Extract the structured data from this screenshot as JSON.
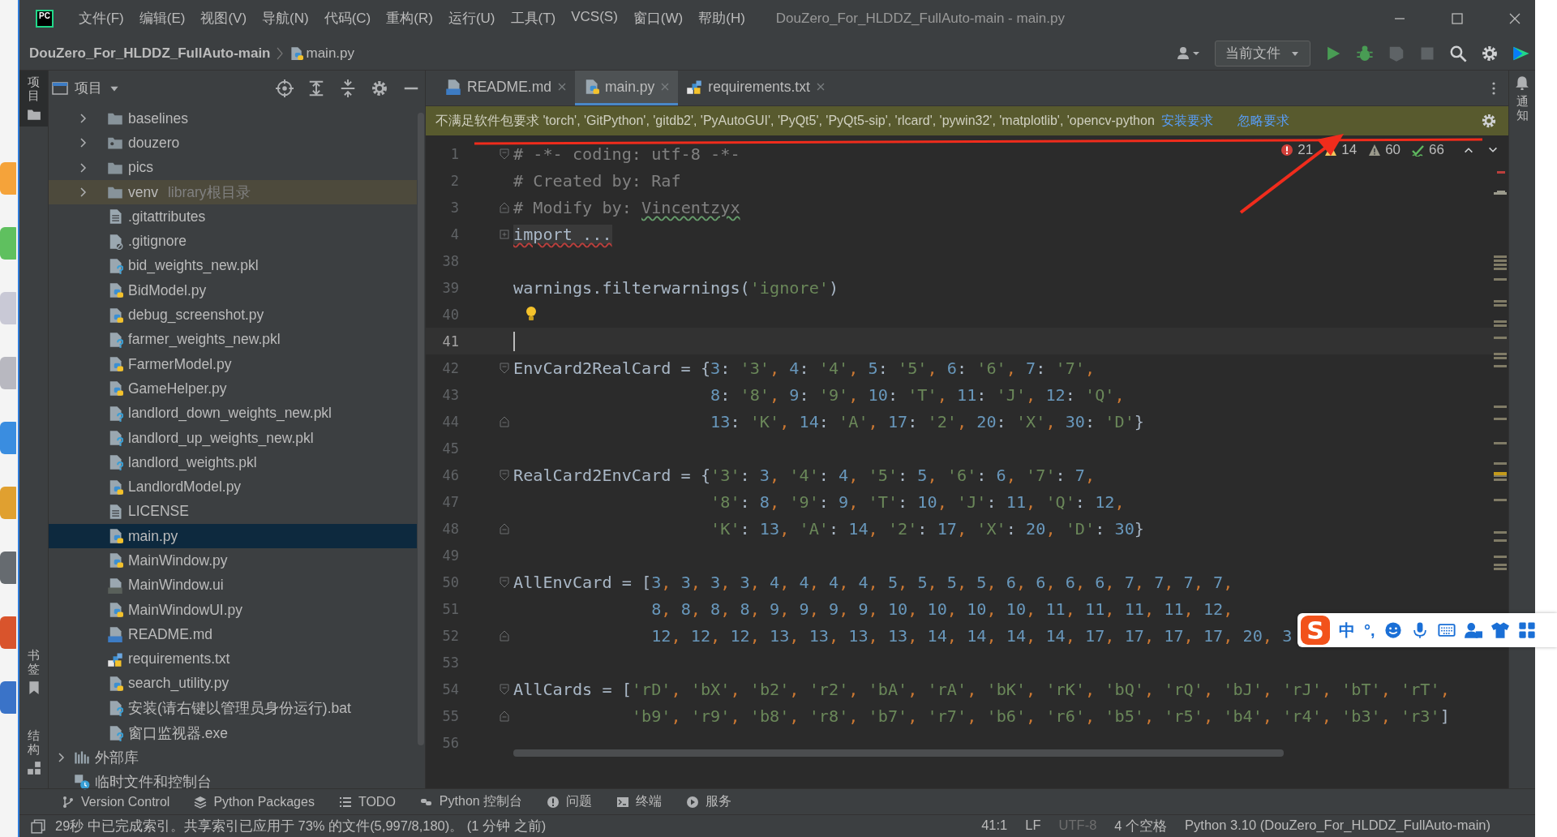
{
  "window": {
    "logo": "PC",
    "menu": [
      "文件(F)",
      "编辑(E)",
      "视图(V)",
      "导航(N)",
      "代码(C)",
      "重构(R)",
      "运行(U)",
      "工具(T)",
      "VCS(S)",
      "窗口(W)",
      "帮助(H)"
    ],
    "title": "DouZero_For_HLDDZ_FullAuto-main - main.py"
  },
  "navbar": {
    "breadcrumb": [
      {
        "label": "DouZero_For_HLDDZ_FullAuto-main",
        "kind": "project"
      },
      {
        "label": "main.py",
        "kind": "python"
      }
    ],
    "run_config": "当前文件"
  },
  "left_stripe": {
    "top": [
      {
        "label": "项目",
        "selected": true,
        "kind": "project"
      }
    ],
    "bottom": [
      {
        "label": "书签",
        "selected": false,
        "kind": "bookmarks"
      },
      {
        "label": "结构",
        "selected": false,
        "kind": "structure"
      }
    ]
  },
  "right_stripe": [
    {
      "label": "通知",
      "kind": "notifications"
    }
  ],
  "project_panel": {
    "title": "项目"
  },
  "tree": {
    "project_children": [
      {
        "label": "baselines",
        "kind": "folder",
        "expanded": false,
        "selected": false,
        "highlighted": false
      },
      {
        "label": "douzero",
        "kind": "module-folder",
        "expanded": false,
        "selected": false,
        "highlighted": false
      },
      {
        "label": "pics",
        "kind": "folder",
        "expanded": false,
        "selected": false,
        "highlighted": false
      },
      {
        "label": "venv",
        "hint": "library根目录",
        "kind": "folder",
        "expanded": false,
        "selected": false,
        "highlighted": true
      },
      {
        "label": ".gitattributes",
        "kind": "text",
        "selected": false,
        "highlighted": false
      },
      {
        "label": ".gitignore",
        "kind": "ignore",
        "selected": false,
        "highlighted": false
      },
      {
        "label": "bid_weights_new.pkl",
        "kind": "unknown",
        "selected": false,
        "highlighted": false
      },
      {
        "label": "BidModel.py",
        "kind": "python",
        "selected": false,
        "highlighted": false
      },
      {
        "label": "debug_screenshot.py",
        "kind": "python",
        "selected": false,
        "highlighted": false
      },
      {
        "label": "farmer_weights_new.pkl",
        "kind": "unknown",
        "selected": false,
        "highlighted": false
      },
      {
        "label": "FarmerModel.py",
        "kind": "python",
        "selected": false,
        "highlighted": false
      },
      {
        "label": "GameHelper.py",
        "kind": "python",
        "selected": false,
        "highlighted": false
      },
      {
        "label": "landlord_down_weights_new.pkl",
        "kind": "unknown",
        "selected": false,
        "highlighted": false
      },
      {
        "label": "landlord_up_weights_new.pkl",
        "kind": "unknown",
        "selected": false,
        "highlighted": false
      },
      {
        "label": "landlord_weights.pkl",
        "kind": "unknown",
        "selected": false,
        "highlighted": false
      },
      {
        "label": "LandlordModel.py",
        "kind": "python",
        "selected": false,
        "highlighted": false
      },
      {
        "label": "LICENSE",
        "kind": "text",
        "selected": false,
        "highlighted": false
      },
      {
        "label": "main.py",
        "kind": "python",
        "selected": true,
        "highlighted": false
      },
      {
        "label": "MainWindow.py",
        "kind": "python",
        "selected": false,
        "highlighted": false
      },
      {
        "label": "MainWindow.ui",
        "kind": "qt",
        "selected": false,
        "highlighted": false
      },
      {
        "label": "MainWindowUI.py",
        "kind": "python",
        "selected": false,
        "highlighted": false
      },
      {
        "label": "README.md",
        "kind": "markdown",
        "selected": false,
        "highlighted": false
      },
      {
        "label": "requirements.txt",
        "kind": "requirements",
        "selected": false,
        "highlighted": false
      },
      {
        "label": "search_utility.py",
        "kind": "python",
        "selected": false,
        "highlighted": false
      },
      {
        "label": "安装(请右键以管理员身份运行).bat",
        "kind": "unknown",
        "selected": false,
        "highlighted": false
      },
      {
        "label": "窗口监视器.exe",
        "kind": "unknown",
        "selected": false,
        "highlighted": false
      }
    ],
    "top_level": [
      {
        "label": "外部库",
        "kind": "library",
        "expanded": false,
        "selected": false,
        "highlighted": false
      },
      {
        "label": "临时文件和控制台",
        "kind": "scratches",
        "selected": false,
        "highlighted": false
      }
    ]
  },
  "tabs": [
    {
      "label": "README.md",
      "kind": "markdown",
      "selected": false
    },
    {
      "label": "main.py",
      "kind": "python",
      "selected": true
    },
    {
      "label": "requirements.txt",
      "kind": "requirements",
      "selected": false
    }
  ],
  "banner": {
    "message": "不满足软件包要求 'torch', 'GitPython', 'gitdb2', 'PyAutoGUI', 'PyQt5', 'PyQt5-sip', 'rlcard', 'pywin32', 'matplotlib', 'opencv-python",
    "actions": [
      "安装要求",
      "忽略要求"
    ]
  },
  "inspections": [
    {
      "kind": "error",
      "count": "21"
    },
    {
      "kind": "warning",
      "count": "14"
    },
    {
      "kind": "weak",
      "count": "60"
    },
    {
      "kind": "typo",
      "count": "66"
    }
  ],
  "code": [
    {
      "number": "1",
      "marker": {
        "kind": "fold-start"
      },
      "bulb": false,
      "current": false,
      "segments": [
        {
          "kind": "comment",
          "text": "# -*- coding: utf-8 -*-"
        }
      ]
    },
    {
      "number": "2",
      "bulb": false,
      "current": false,
      "segments": [
        {
          "kind": "comment",
          "text": "# Created by: Raf"
        }
      ]
    },
    {
      "number": "3",
      "marker": {
        "kind": "fold-end"
      },
      "bulb": false,
      "current": false,
      "segments": [
        {
          "kind": "comment",
          "text": "# Modify by: "
        },
        {
          "kind": "comment-typo",
          "text": "Vincentzyx"
        }
      ]
    },
    {
      "number": "4",
      "marker": {
        "kind": "fold-collapsed"
      },
      "bulb": false,
      "current": false,
      "segments": [
        {
          "kind": "folded",
          "text": "import ..."
        }
      ]
    },
    {
      "number": "38",
      "bulb": false,
      "current": false
    },
    {
      "number": "39",
      "bulb": false,
      "current": false,
      "segments": [
        {
          "kind": "code",
          "text": "warnings.filterwarnings('ignore')"
        }
      ]
    },
    {
      "number": "40",
      "bulb": true,
      "current": false
    },
    {
      "number": "41",
      "bulb": false,
      "current": true
    },
    {
      "number": "42",
      "marker": {
        "kind": "fold-start"
      },
      "bulb": false,
      "current": false,
      "segments": [
        {
          "kind": "code",
          "text": "EnvCard2RealCard = {3: '3', 4: '4', 5: '5', 6: '6', 7: '7',"
        }
      ]
    },
    {
      "number": "43",
      "bulb": false,
      "current": false,
      "segments": [
        {
          "kind": "code",
          "text": "                    8: '8', 9: '9', 10: 'T', 11: 'J', 12: 'Q',"
        }
      ]
    },
    {
      "number": "44",
      "marker": {
        "kind": "fold-end"
      },
      "bulb": false,
      "current": false,
      "segments": [
        {
          "kind": "code",
          "text": "                    13: 'K', 14: 'A', 17: '2', 20: 'X', 30: 'D'}"
        }
      ]
    },
    {
      "number": "45",
      "bulb": false,
      "current": false
    },
    {
      "number": "46",
      "marker": {
        "kind": "fold-start"
      },
      "bulb": false,
      "current": false,
      "segments": [
        {
          "kind": "code",
          "text": "RealCard2EnvCard = {'3': 3, '4': 4, '5': 5, '6': 6, '7': 7,"
        }
      ]
    },
    {
      "number": "47",
      "bulb": false,
      "current": false,
      "segments": [
        {
          "kind": "code",
          "text": "                    '8': 8, '9': 9, 'T': 10, 'J': 11, 'Q': 12,"
        }
      ]
    },
    {
      "number": "48",
      "marker": {
        "kind": "fold-end"
      },
      "bulb": false,
      "current": false,
      "segments": [
        {
          "kind": "code",
          "text": "                    'K': 13, 'A': 14, '2': 17, 'X': 20, 'D': 30}"
        }
      ]
    },
    {
      "number": "49",
      "bulb": false,
      "current": false
    },
    {
      "number": "50",
      "marker": {
        "kind": "fold-start"
      },
      "bulb": false,
      "current": false,
      "segments": [
        {
          "kind": "code",
          "text": "AllEnvCard = [3, 3, 3, 3, 4, 4, 4, 4, 5, 5, 5, 5, 6, 6, 6, 6, 7, 7, 7, 7,"
        }
      ]
    },
    {
      "number": "51",
      "bulb": false,
      "current": false,
      "segments": [
        {
          "kind": "code",
          "text": "              8, 8, 8, 8, 9, 9, 9, 9, 10, 10, 10, 10, 11, 11, 11, 11, 12,"
        }
      ]
    },
    {
      "number": "52",
      "marker": {
        "kind": "fold-end"
      },
      "bulb": false,
      "current": false,
      "segments": [
        {
          "kind": "code",
          "text": "              12, 12, 12, 13, 13, 13, 13, 14, 14, 14, 14, 17, 17, 17, 17, 20, 3"
        }
      ]
    },
    {
      "number": "53",
      "bulb": false,
      "current": false
    },
    {
      "number": "54",
      "marker": {
        "kind": "fold-start"
      },
      "bulb": false,
      "current": false,
      "segments": [
        {
          "kind": "code",
          "text": "AllCards = ['rD', 'bX', 'b2', 'r2', 'bA', 'rA', 'bK', 'rK', 'bQ', 'rQ', 'bJ', 'rJ', 'bT', 'rT',"
        }
      ]
    },
    {
      "number": "55",
      "marker": {
        "kind": "fold-end"
      },
      "bulb": false,
      "current": false,
      "segments": [
        {
          "kind": "code",
          "text": "            'b9', 'r9', 'b8', 'r8', 'b7', 'r7', 'b6', 'r6', 'b5', 'r5', 'b4', 'r4', 'b3', 'r3']"
        }
      ]
    },
    {
      "number": "56",
      "bulb": false,
      "current": false
    }
  ],
  "ime": {
    "logo": "S",
    "mode": "中",
    "punctuation": "°,"
  },
  "bottom_tools": [
    {
      "label": "Version Control",
      "kind": "vcs"
    },
    {
      "label": "Python Packages",
      "kind": "packages"
    },
    {
      "label": "TODO",
      "kind": "todo"
    },
    {
      "label": "Python 控制台",
      "kind": "console"
    },
    {
      "label": "问题",
      "kind": "problems"
    },
    {
      "label": "终端",
      "kind": "terminal"
    },
    {
      "label": "服务",
      "kind": "services"
    }
  ],
  "status_bar": {
    "message": "29秒 中已完成索引。共享索引已应用于 73% 的文件(5,997/8,180)。 (1 分钟 之前)",
    "items": [
      {
        "text": "41:1",
        "disabled": false
      },
      {
        "text": "LF",
        "disabled": false
      },
      {
        "text": "UTF-8",
        "disabled": true
      },
      {
        "text": "4 个空格",
        "disabled": false
      },
      {
        "text": "Python 3.10 (DouZero_For_HLDDZ_FullAuto-main)",
        "disabled": false
      }
    ]
  }
}
